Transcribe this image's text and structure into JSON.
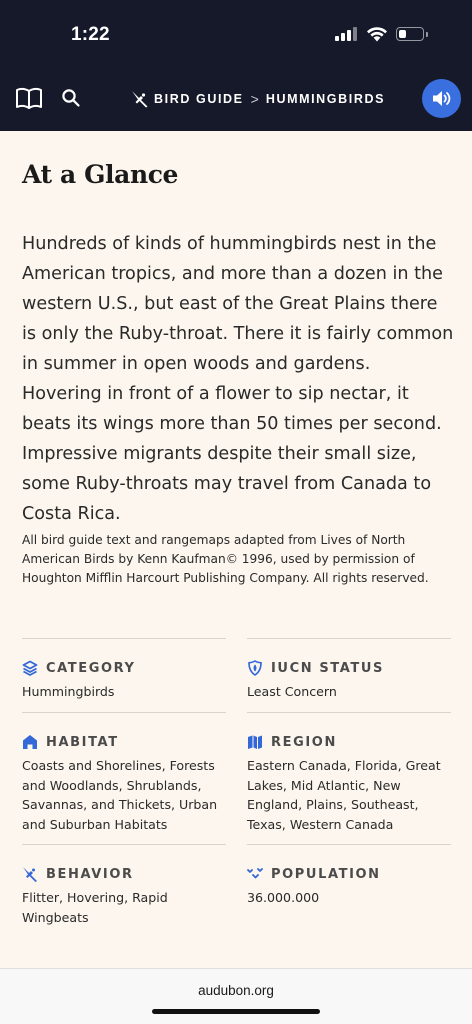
{
  "status_bar": {
    "time": "1:22",
    "battery_level": 0.3
  },
  "nav": {
    "book_icon": "book-icon",
    "search_icon": "search-icon",
    "breadcrumb_root": "BIRD GUIDE",
    "breadcrumb_separator": ">",
    "breadcrumb_current": "HUMMINGBIRDS",
    "audio_icon": "speaker-icon"
  },
  "main": {
    "title": "At a Glance",
    "description": "Hundreds of kinds of hummingbirds nest in the American tropics, and more than a dozen in the western U.S., but east of the Great Plains there is only the Ruby-throat. There it is fairly common in summer in open woods and gardens. Hovering in front of a flower to sip nectar, it beats its wings more than 50 times per second. Impressive migrants despite their small size, some Ruby-throats may travel from Canada to Costa Rica.",
    "credit": "All bird guide text and rangemaps adapted from Lives of North American Birds by Kenn Kaufman© 1996, used by permission of Houghton Mifflin Harcourt Publishing Company. All rights reserved."
  },
  "facts": [
    {
      "label": "CATEGORY",
      "value": "Hummingbirds",
      "icon": "layers-icon"
    },
    {
      "label": "IUCN STATUS",
      "value": "Least Concern",
      "icon": "shield-icon"
    },
    {
      "label": "HABITAT",
      "value": "Coasts and Shorelines, Forests and Woodlands, Shrublands, Savannas, and Thickets, Urban and Suburban Habitats",
      "icon": "house-icon"
    },
    {
      "label": "REGION",
      "value": "Eastern Canada, Florida, Great Lakes, Mid Atlantic, New England, Plains, Southeast, Texas, Western Canada",
      "icon": "map-icon"
    },
    {
      "label": "BEHAVIOR",
      "value": "Flitter, Hovering, Rapid Wingbeats",
      "icon": "bird-icon"
    },
    {
      "label": "POPULATION",
      "value": "36.000.000",
      "icon": "flock-icon"
    }
  ],
  "browser": {
    "url": "audubon.org"
  },
  "colors": {
    "nav_bg": "#16192a",
    "accent": "#3a6fe0",
    "page_bg": "#fcf6ee",
    "icon_blue": "#3468d8"
  }
}
